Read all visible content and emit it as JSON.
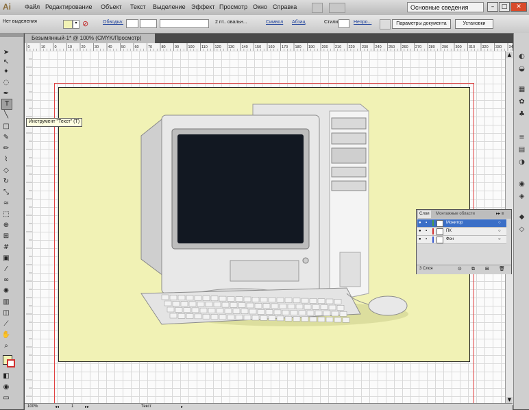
{
  "menubar": {
    "logo": "Ai",
    "items": [
      "Файл",
      "Редактирование",
      "Объект",
      "Текст",
      "Выделение",
      "Эффект",
      "Просмотр",
      "Окно",
      "Справка"
    ],
    "workspace": "Основные сведения"
  },
  "control_bar": {
    "no_selection": "Нет выделения",
    "stroke_label": "Обводка:",
    "brush_value": "2 пт.. овальн...",
    "symbol_label": "Символ",
    "paragraph_label": "Абзац",
    "styles_label": "Стили:",
    "opacity_label": "Непро...",
    "doc_settings_button": "Параметры документа",
    "prefs_button": "Установки"
  },
  "document": {
    "tab_title": "Безымянный-1* @ 100% (CMYK/Просмотр)",
    "ruler_ticks": [
      "0",
      "10",
      "0",
      "10",
      "20",
      "30",
      "40",
      "50",
      "60",
      "70",
      "80",
      "90",
      "100",
      "110",
      "120",
      "130",
      "140",
      "150",
      "160",
      "170",
      "180",
      "190",
      "200",
      "210",
      "220",
      "230",
      "240",
      "250",
      "260",
      "270",
      "280",
      "290",
      "300",
      "310",
      "320",
      "330",
      "34"
    ]
  },
  "tooltip": "Инструмент \"Текст\" (T)",
  "layers_panel": {
    "tabs": [
      "Слои",
      "Монтажные области"
    ],
    "layers": [
      {
        "name": "Монитор",
        "color": "#4a9a4a",
        "selected": true
      },
      {
        "name": "ПК",
        "color": "#d03030",
        "selected": false
      },
      {
        "name": "Фон",
        "color": "#3a5ad0",
        "selected": false
      }
    ],
    "footer": "3 Слоя"
  },
  "status_bar": {
    "zoom": "100%",
    "page": "1",
    "tool": "Текст"
  }
}
